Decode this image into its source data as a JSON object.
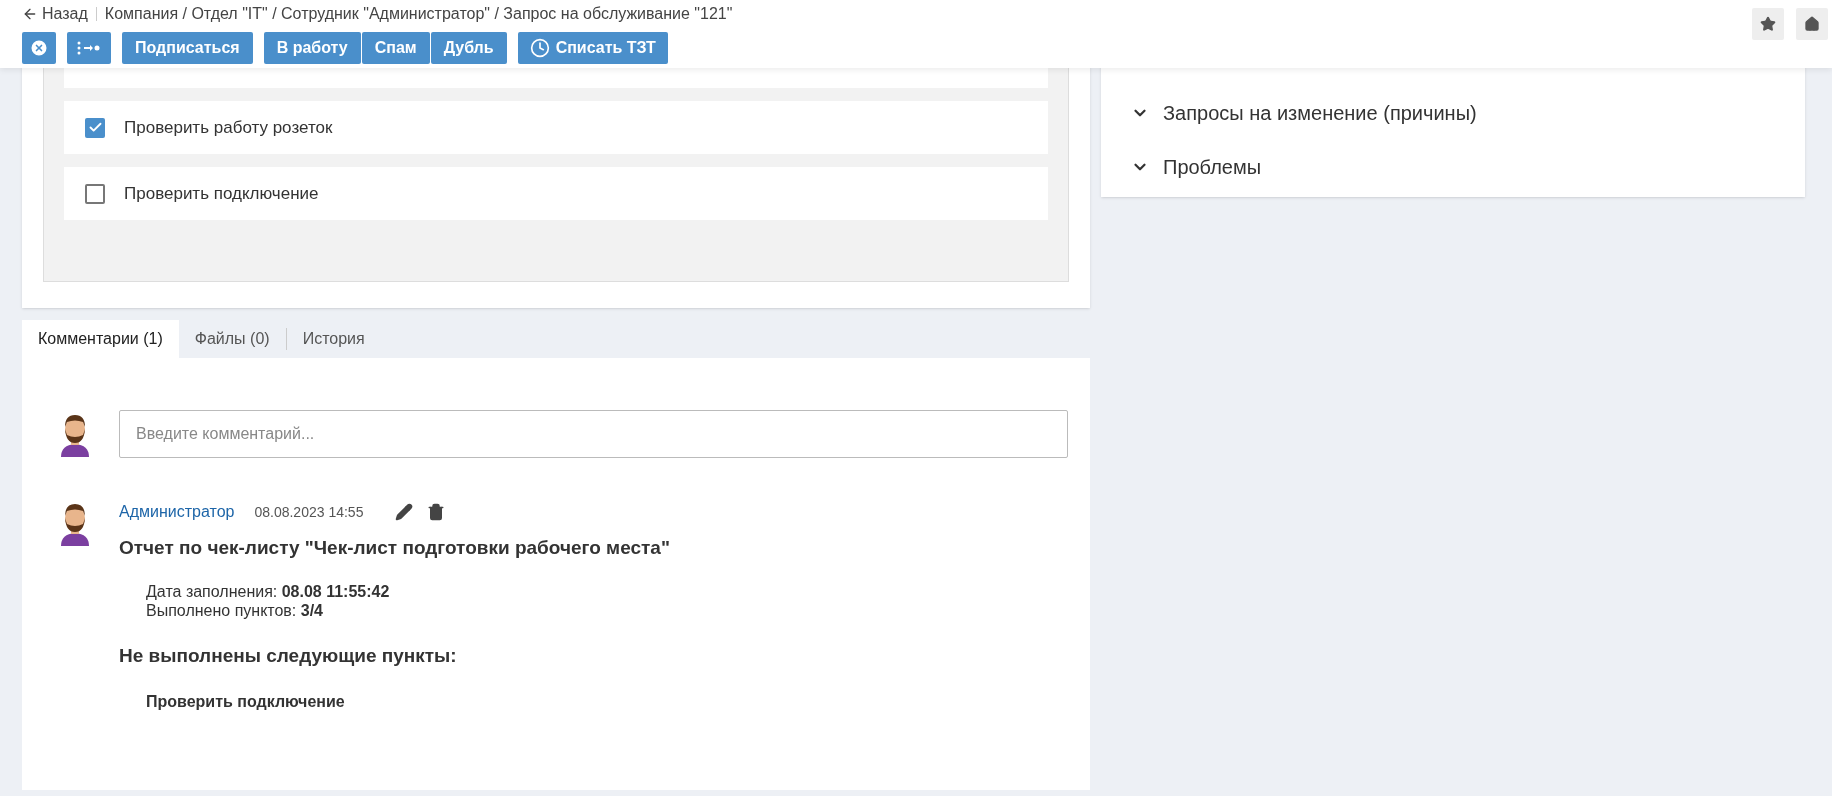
{
  "breadcrumb": {
    "back": "Назад",
    "path": "Компания / Отдел \"IT\" / Сотрудник \"Администратор\" / Запрос на обслуживание \"121\""
  },
  "toolbar": {
    "groups": [
      {
        "buttons": [
          "Подписаться"
        ]
      },
      {
        "buttons": [
          "В работу",
          "Спам",
          "Дубль"
        ]
      }
    ],
    "timer_button": "Списать ТЗТ"
  },
  "checklist": [
    {
      "label": "Проверить работу розеток",
      "checked": true
    },
    {
      "label": "Проверить подключение",
      "checked": false
    }
  ],
  "related": [
    "Запросы на изменение (причины)",
    "Проблемы"
  ],
  "tabs": [
    {
      "label": "Комментарии (1)",
      "selected": true
    },
    {
      "label": "Файлы (0)",
      "selected": false
    },
    {
      "label": "История",
      "selected": false
    }
  ],
  "comment_input": {
    "placeholder": "Введите комментарий..."
  },
  "comment": {
    "author": "Администратор",
    "time": "08.08.2023 14:55",
    "title": "Отчет по чек-листу \"Чек-лист подготовки рабочего места\"",
    "details": [
      "Дата заполнения: **08.08 11:55:42**",
      "Выполнено пунктов: **3/4**"
    ],
    "heading": "Не выполнены следующие пункты:",
    "items": [
      "Проверить подключение"
    ]
  }
}
